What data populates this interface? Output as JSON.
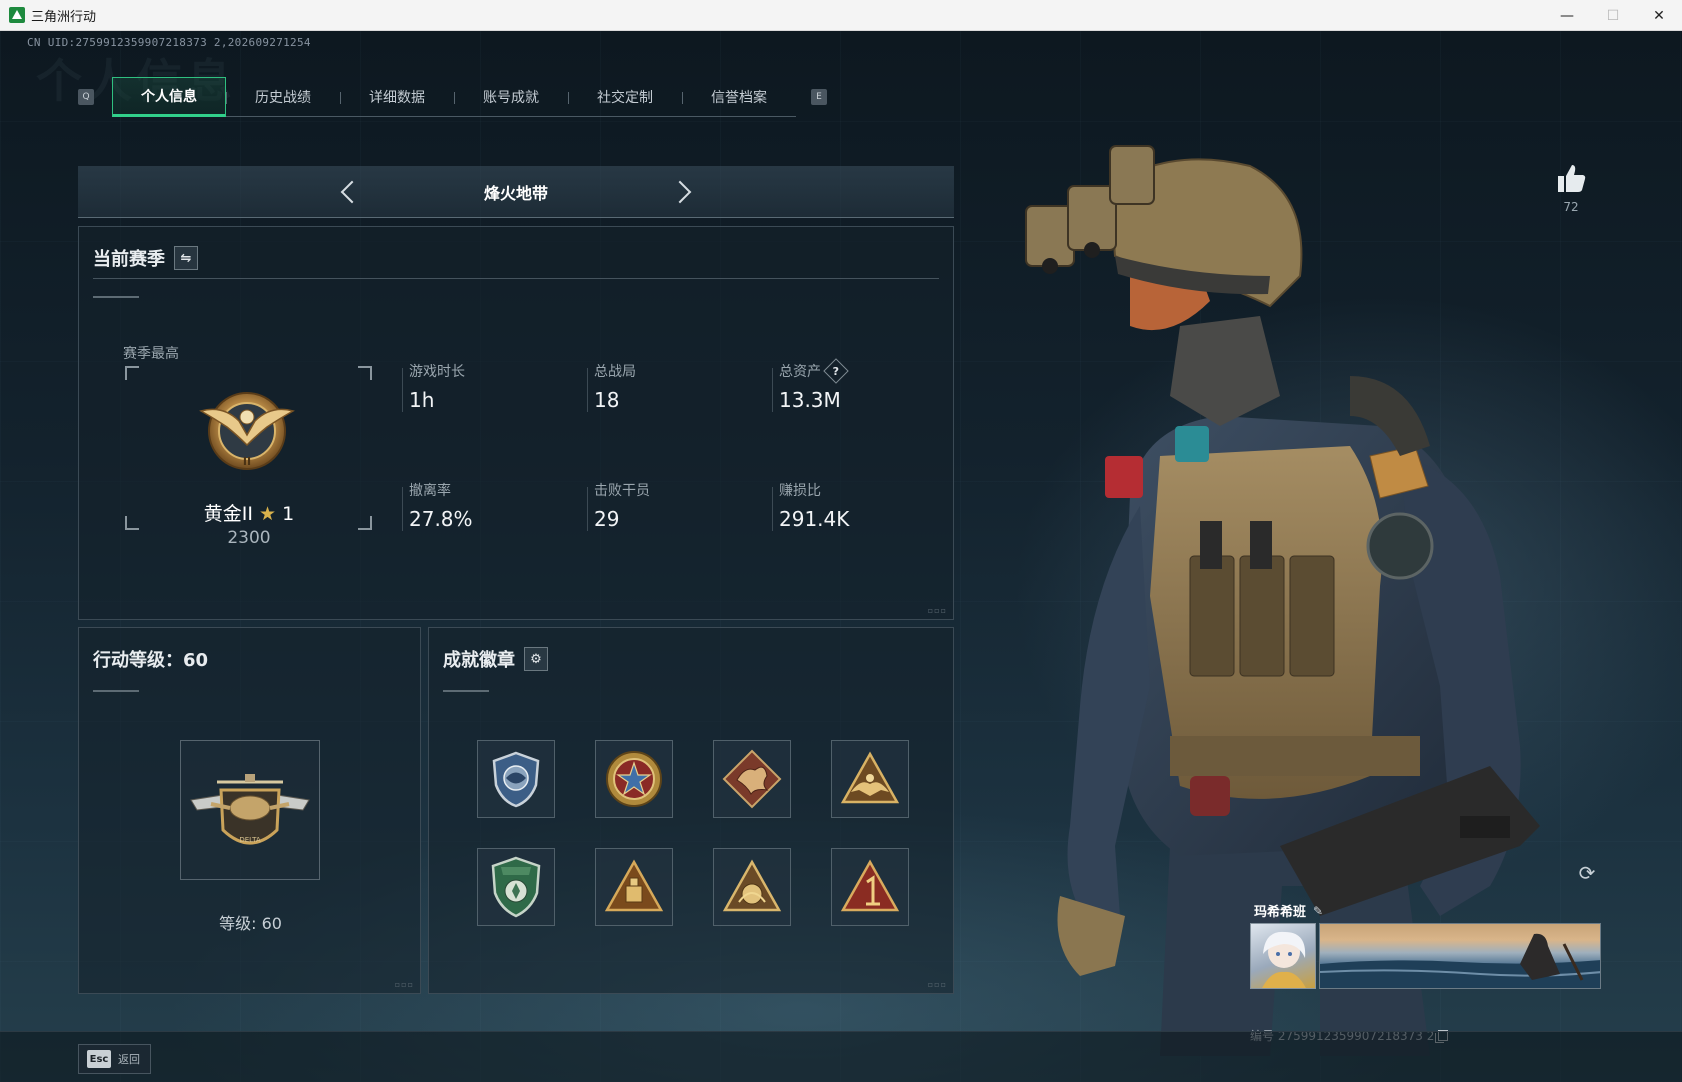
{
  "window": {
    "title": "三角洲行动",
    "controls": {
      "minimize": "—",
      "maximize": "☐",
      "close": "✕"
    }
  },
  "uid_text": "CN UID:2759912359907218373 2,202609271254",
  "watermark": "个人信息",
  "tabs": {
    "prev_key": "Q",
    "next_key": "E",
    "items": [
      {
        "label": "个人信息",
        "active": true
      },
      {
        "label": "历史战绩",
        "active": false
      },
      {
        "label": "详细数据",
        "active": false
      },
      {
        "label": "账号成就",
        "active": false
      },
      {
        "label": "社交定制",
        "active": false
      },
      {
        "label": "信誉档案",
        "active": false
      }
    ]
  },
  "mode": {
    "title": "烽火地带"
  },
  "season": {
    "title": "当前赛季",
    "switch_icon": "swap-icon",
    "best_label": "赛季最高",
    "rank_name": "黄金II",
    "rank_stars": "1",
    "rank_score": "2300",
    "stats": [
      {
        "label": "游戏时长",
        "value": "1h"
      },
      {
        "label": "总战局",
        "value": "18"
      },
      {
        "label": "总资产",
        "value": "13.3M",
        "help": "?"
      },
      {
        "label": "撤离率",
        "value": "27.8%"
      },
      {
        "label": "击败干员",
        "value": "29"
      },
      {
        "label": "赚损比",
        "value": "291.4K"
      }
    ]
  },
  "level": {
    "title": "行动等级：60",
    "caption_label": "等级:",
    "caption_value": "60"
  },
  "badges": {
    "title": "成就徽章",
    "settings_icon": "gear-icon",
    "items": [
      {
        "icon": "shield-blue-badge-icon"
      },
      {
        "icon": "star-medal-badge-icon"
      },
      {
        "icon": "dragon-diamond-badge-icon"
      },
      {
        "icon": "eagle-triangle-badge-icon"
      },
      {
        "icon": "green-shield-badge-icon"
      },
      {
        "icon": "supply-triangle-badge-icon"
      },
      {
        "icon": "emblem-triangle-badge-icon"
      },
      {
        "icon": "number-one-triangle-badge-icon"
      }
    ]
  },
  "likes": {
    "count": "72"
  },
  "namecard": {
    "name": "玛希希班",
    "id_text": "编号 2759912359907218373 2"
  },
  "bottom": {
    "esc_key": "Esc",
    "esc_label": "返回"
  },
  "colors": {
    "accent": "#31d08a",
    "gold": "#d9b24c"
  }
}
